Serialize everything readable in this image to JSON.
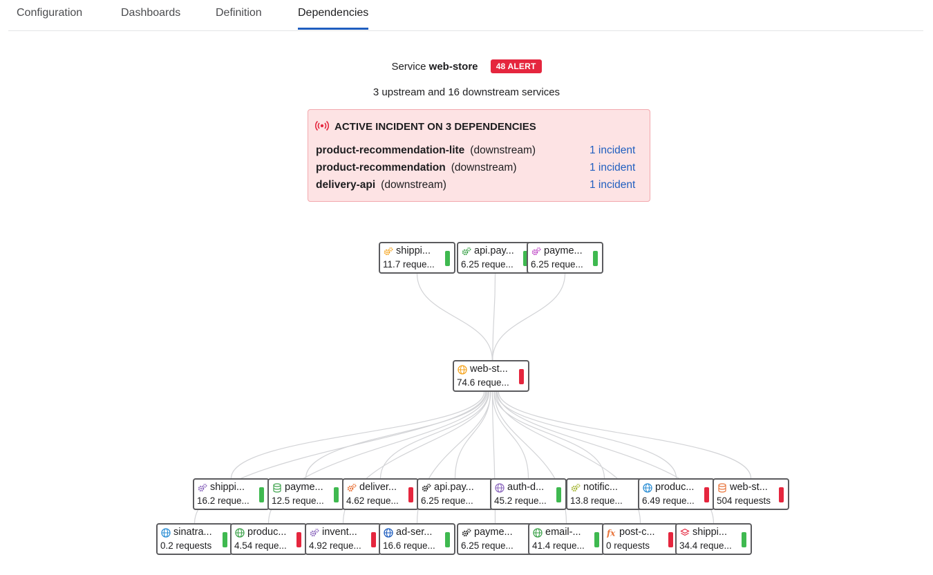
{
  "tabs": [
    {
      "label": "Configuration",
      "active": false
    },
    {
      "label": "Dashboards",
      "active": false
    },
    {
      "label": "Definition",
      "active": false
    },
    {
      "label": "Dependencies",
      "active": true
    }
  ],
  "service": {
    "prefix": "Service",
    "name": "web-store",
    "alert_badge": "48 ALERT",
    "summary": "3 upstream and 16 downstream services"
  },
  "incident": {
    "title": "ACTIVE INCIDENT ON 3 DEPENDENCIES",
    "rows": [
      {
        "name": "product-recommendation-lite",
        "direction": "(downstream)",
        "link": "1 incident"
      },
      {
        "name": "product-recommendation",
        "direction": "(downstream)",
        "link": "1 incident"
      },
      {
        "name": "delivery-api",
        "direction": "(downstream)",
        "link": "1 incident"
      }
    ]
  },
  "colors": {
    "ok": "#3fb950",
    "alert": "#e5263e",
    "link": "#1f5ebf",
    "edge": "#d2d3d6"
  },
  "graph": {
    "upstream": [
      {
        "name": "shippi...",
        "requests": "11.7 reque...",
        "icon": "gears-icon",
        "icon_color": "#f5a623",
        "status": "ok"
      },
      {
        "name": "api.pay...",
        "requests": "6.25 reque...",
        "icon": "gears-icon",
        "icon_color": "#3fa34d",
        "status": "ok"
      },
      {
        "name": "payme...",
        "requests": "6.25 reque...",
        "icon": "gears-icon",
        "icon_color": "#c04bc7",
        "status": "ok"
      }
    ],
    "center": {
      "name": "web-st...",
      "requests": "74.6 reque...",
      "icon": "globe-icon",
      "icon_color": "#f5a623",
      "status": "alert"
    },
    "downstream_row1": [
      {
        "name": "shippi...",
        "requests": "16.2 reque...",
        "icon": "gears-icon",
        "icon_color": "#8e6bbf",
        "status": "ok"
      },
      {
        "name": "payme...",
        "requests": "12.5 reque...",
        "icon": "database-icon",
        "icon_color": "#3fa34d",
        "status": "ok"
      },
      {
        "name": "deliver...",
        "requests": "4.62 reque...",
        "icon": "gears-icon",
        "icon_color": "#e8743b",
        "status": "alert"
      },
      {
        "name": "api.pay...",
        "requests": "6.25 reque...",
        "icon": "gears-icon",
        "icon_color": "#2b2b2b",
        "status": "none"
      },
      {
        "name": "auth-d...",
        "requests": "45.2 reque...",
        "icon": "globe-icon",
        "icon_color": "#8e6bbf",
        "status": "ok"
      },
      {
        "name": "notific...",
        "requests": "13.8 reque...",
        "icon": "gears-icon",
        "icon_color": "#a8b83a",
        "status": "none"
      },
      {
        "name": "produc...",
        "requests": "6.49 reque...",
        "icon": "globe-icon",
        "icon_color": "#2d8fd5",
        "status": "alert"
      },
      {
        "name": "web-st...",
        "requests": "504 requests",
        "icon": "database-icon",
        "icon_color": "#e8743b",
        "status": "alert"
      }
    ],
    "downstream_row2": [
      {
        "name": "sinatra...",
        "requests": "0.2 requests",
        "icon": "globe-icon",
        "icon_color": "#2d8fd5",
        "status": "ok"
      },
      {
        "name": "produc...",
        "requests": "4.54 reque...",
        "icon": "globe-icon",
        "icon_color": "#3fa34d",
        "status": "alert"
      },
      {
        "name": "invent...",
        "requests": "4.92 reque...",
        "icon": "gears-icon",
        "icon_color": "#8e6bbf",
        "status": "alert"
      },
      {
        "name": "ad-ser...",
        "requests": "16.6 reque...",
        "icon": "globe-icon",
        "icon_color": "#1f5ebf",
        "status": "ok"
      },
      {
        "name": "payme...",
        "requests": "6.25 reque...",
        "icon": "gears-icon",
        "icon_color": "#2b2b2b",
        "status": "none"
      },
      {
        "name": "email-...",
        "requests": "41.4 reque...",
        "icon": "globe-icon",
        "icon_color": "#3fa34d",
        "status": "ok"
      },
      {
        "name": "post-c...",
        "requests": "0 requests",
        "icon": "function-icon",
        "icon_color": "#e8743b",
        "status": "alert"
      },
      {
        "name": "shippi...",
        "requests": "34.4 reque...",
        "icon": "layers-icon",
        "icon_color": "#e5263e",
        "status": "ok"
      }
    ]
  }
}
